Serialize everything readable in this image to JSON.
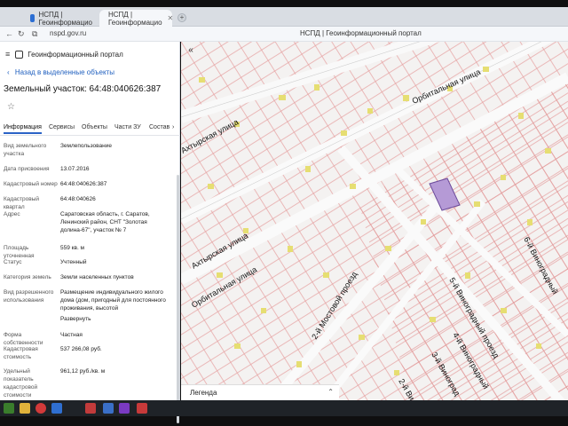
{
  "browser": {
    "tabs": [
      {
        "label": "НСПД | Геоинформацио"
      },
      {
        "label": "НСПД | Геоинформацио"
      }
    ],
    "new_tab": "+",
    "url": "nspd.gov.ru",
    "window_title": "НСПД | Геоинформационный портал"
  },
  "panel": {
    "brand": "Геоинформационный портал",
    "back": "Назад в выделенные объекты",
    "title": "Земельный участок: 64:48:040626:387",
    "star": "☆",
    "tabs": [
      "Информация",
      "Сервисы",
      "Объекты",
      "Части ЗУ",
      "Состав"
    ],
    "tab_more": "›",
    "rows": [
      {
        "k": "Вид земельного участка",
        "v": "Землепользование"
      },
      {
        "k": "Дата присвоения",
        "v": "13.07.2016"
      },
      {
        "k": "Кадастровый номер",
        "v": "64:48:040626:387"
      },
      {
        "k": "Кадастровый квартал",
        "v": "64:48:040626"
      },
      {
        "k": "Адрес",
        "v": "Саратовская область, г. Саратов, Ленинский район, СНТ \"Золотая долина-67\", участок № 7"
      },
      {
        "k": "Площадь уточненная",
        "v": "559 кв. м"
      },
      {
        "k": "Статус",
        "v": "Учтенный"
      },
      {
        "k": "Категория земель",
        "v": "Земли населенных пунктов"
      },
      {
        "k": "Вид разрешенного использования",
        "v": "Размещение индивидуального жилого дома (дом, пригодный для постоянного проживания, высотой"
      },
      {
        "k": "Форма собственности",
        "v": "Частная"
      },
      {
        "k": "Кадастровая стоимость",
        "v": "537 266,08 руб."
      },
      {
        "k": "Удельный показатель кадастровой стоимости",
        "v": "961,12 руб./кв. м"
      }
    ],
    "expand_link": "Развернуть"
  },
  "map": {
    "collapse": "«",
    "streets": [
      {
        "label": "Орбитальная улица"
      },
      {
        "label": "Ахтырская улица"
      },
      {
        "label": "Ахтырская улица"
      },
      {
        "label": "Орбитальная улица"
      },
      {
        "label": "2-й Мостовой проезд"
      },
      {
        "label": "5-й Виноградный проезд"
      },
      {
        "label": "6-й Виноградный"
      },
      {
        "label": "4-й Виноградный"
      },
      {
        "label": "3-й Виноград"
      },
      {
        "label": "2-й Ви"
      }
    ],
    "legend": "Легенда",
    "legend_chevron": "⌃"
  },
  "colors": {
    "accent": "#2b63c7",
    "parcel_highlight": "#b59ad6",
    "parcel_line": "#e18a8a",
    "building": "#e8e07a"
  }
}
